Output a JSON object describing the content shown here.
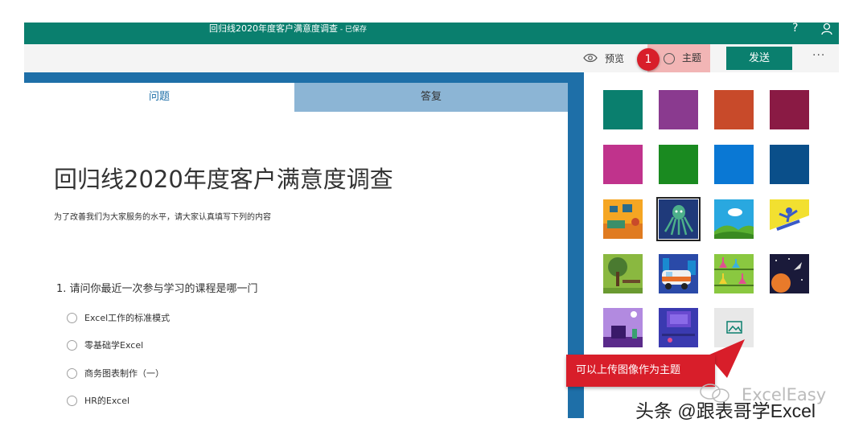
{
  "header": {
    "title": "回归线2020年度客户满意度调查",
    "saved_status": " - 已保存",
    "help_glyph": "?"
  },
  "toolbar": {
    "preview_label": "预览",
    "theme_label": "主题",
    "send_label": "发送",
    "more_glyph": "···",
    "callout_number": "1"
  },
  "tabs": [
    {
      "label": "问题",
      "active": true
    },
    {
      "label": "答复",
      "active": false
    }
  ],
  "form": {
    "title": "回归线2020年度客户满意度调查",
    "description": "为了改善我们为大家服务的水平，请大家认真填写下列的内容",
    "question": "1. 请问你最近一次参与学习的课程是哪一门",
    "options": [
      "Excel工作的标准模式",
      "零基础学Excel",
      "商务图表制作（一）",
      "HR的Excel"
    ]
  },
  "themes": {
    "colors": [
      "#0a7f6e",
      "#8a3a8f",
      "#c84a2a",
      "#8a1a44",
      "#c0338c",
      "#1a8a20",
      "#0a78d4",
      "#0a4f8a"
    ],
    "images": [
      "room-scene",
      "octopus-scene",
      "sky-hills-scene",
      "snowboard-scene",
      "tree-bench-scene",
      "van-city-scene",
      "lab-flasks-scene",
      "space-rocket-scene",
      "desk-lamp-scene",
      "computer-desk-scene"
    ],
    "selected": "octopus-scene",
    "upload_icon": "image-upload-icon"
  },
  "annotation": {
    "text": "可以上传图像作为主题"
  },
  "watermark": {
    "logo_text": "ExcelEasy",
    "credit": "头条 @跟表哥学Excel"
  }
}
